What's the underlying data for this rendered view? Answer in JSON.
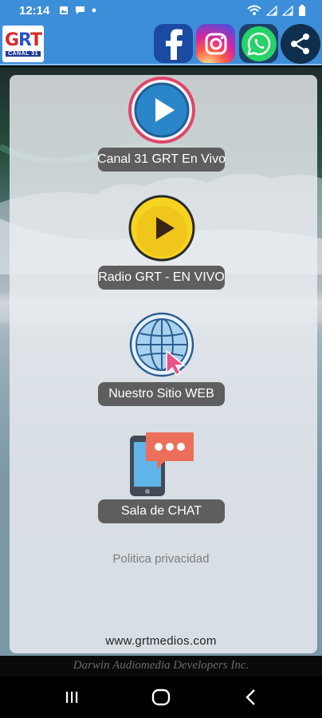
{
  "status": {
    "time": "12:14",
    "left_icons": [
      "photo-icon",
      "chat-bubble-icon",
      "dot-icon"
    ],
    "right_icons": [
      "wifi-icon",
      "signal-icon",
      "signal-icon",
      "battery-icon"
    ]
  },
  "header": {
    "logo_letters": [
      "G",
      "R",
      "T"
    ],
    "logo_sub": "CANAL 31",
    "social": [
      "facebook-icon",
      "instagram-icon",
      "whatsapp-icon",
      "share-icon"
    ]
  },
  "menu": [
    {
      "label": "Canal 31 GRT En Vivo",
      "icon": "play-icon"
    },
    {
      "label": "Radio GRT - EN VIVO",
      "icon": "radio-play-icon"
    },
    {
      "label": "Nuestro Sitio WEB",
      "icon": "globe-icon"
    },
    {
      "label": "Sala de CHAT",
      "icon": "chat-icon"
    }
  ],
  "privacy_link": "Politica privacidad",
  "website": "www.grtmedios.com",
  "developer": "Darwin Audiomedia Developers Inc.",
  "nav": [
    "recent-apps-icon",
    "home-icon",
    "back-icon"
  ],
  "colors": {
    "header": "#3d8ed8",
    "button_bg": "#5e5e5e",
    "play_yellow": "#f6d321",
    "play_blue": "#2a86c9"
  }
}
